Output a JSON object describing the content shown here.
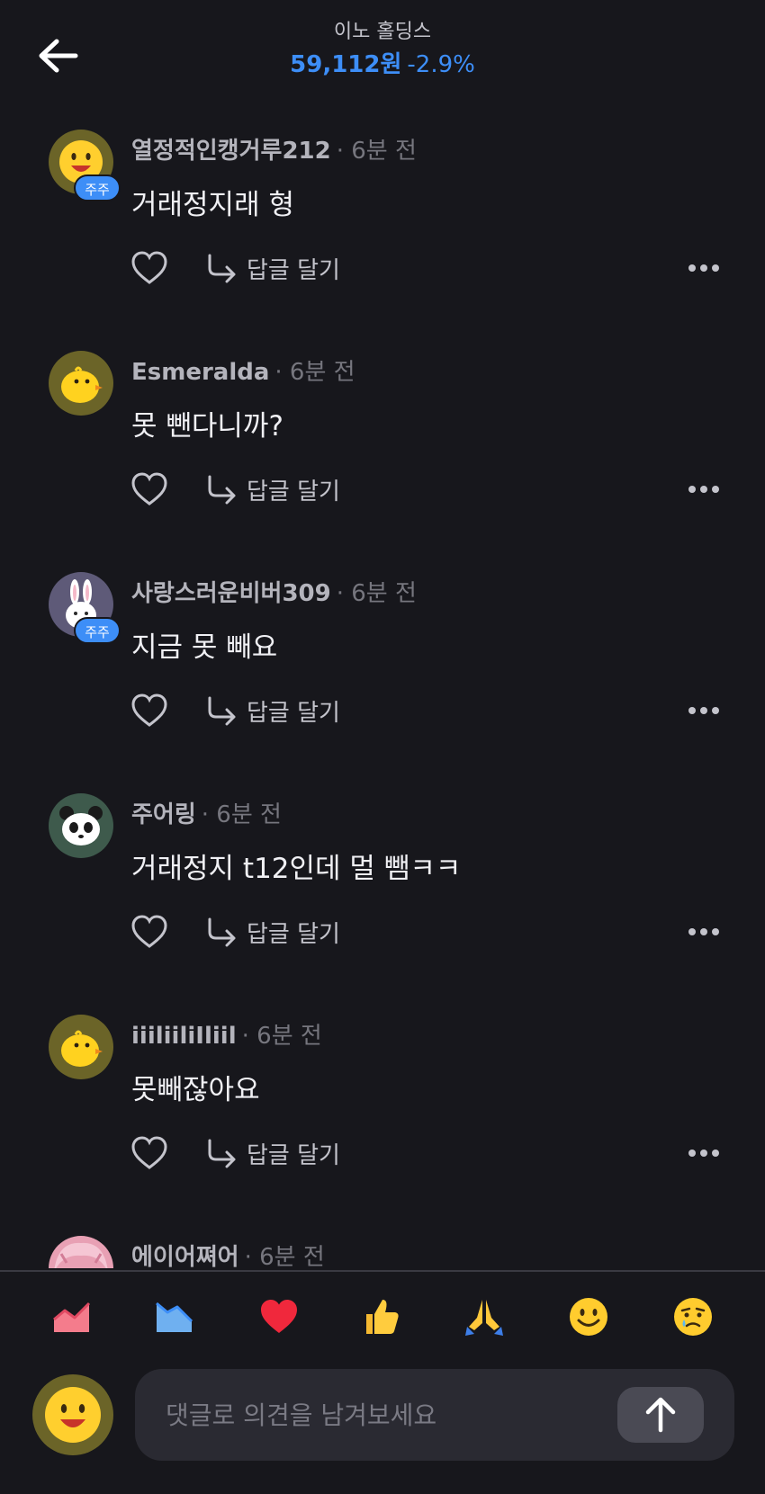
{
  "header": {
    "stock_name": "이노 홀딩스",
    "price": "59,112원",
    "change": "-2.9%",
    "accent_color": "#3d8ef7"
  },
  "comments": [
    {
      "username": "열정적인캥거루212",
      "time": "· 6분 전",
      "text": "거래정지래 형",
      "avatar": "smiley",
      "badge": "주주",
      "reply_label": "답글 달기"
    },
    {
      "username": "Esmeralda",
      "time": "· 6분 전",
      "text": "못 뺀다니까?",
      "avatar": "chick",
      "reply_label": "답글 달기"
    },
    {
      "username": "사랑스러운비버309",
      "time": "· 6분 전",
      "text": "지금 못 빼요",
      "avatar": "rabbit",
      "badge": "주주",
      "reply_label": "답글 달기"
    },
    {
      "username": "주어링",
      "time": "· 6분 전",
      "text": "거래정지 t12인데 멀 뺌ㅋㅋ",
      "avatar": "panda",
      "reply_label": "답글 달기"
    },
    {
      "username": "iiiliiliIliil",
      "time": "· 6분 전",
      "text": "못빼잖아요",
      "avatar": "chick",
      "reply_label": "답글 달기"
    },
    {
      "username": "에이어쪄어",
      "time": "· 6분 전",
      "text": "",
      "avatar": "pink-character"
    }
  ],
  "reactions": [
    "chart-up-icon",
    "chart-down-icon",
    "heart-icon",
    "thumbs-up-icon",
    "pray-icon",
    "smile-icon",
    "sad-icon"
  ],
  "composer": {
    "placeholder": "댓글로 의견을 남겨보세요",
    "avatar": "smiley"
  }
}
